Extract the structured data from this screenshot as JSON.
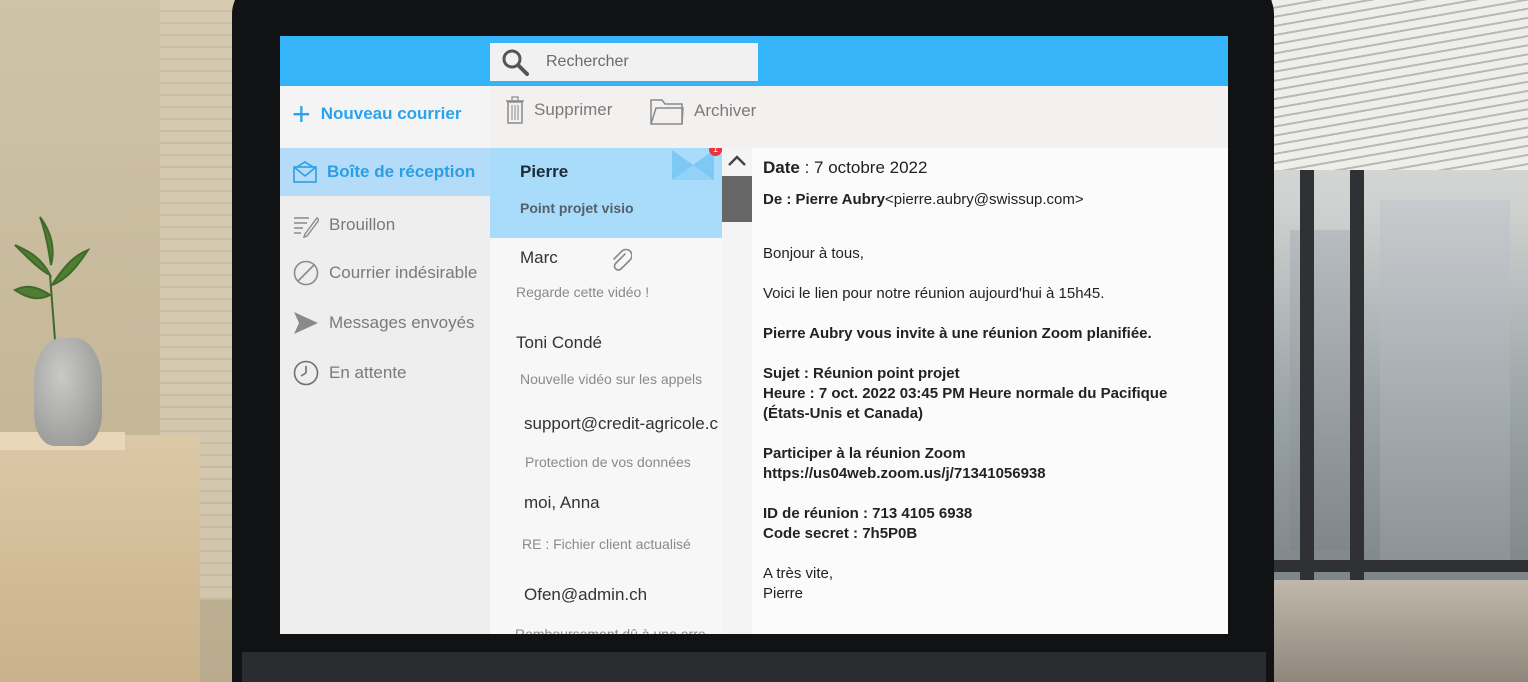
{
  "search": {
    "placeholder": "Rechercher"
  },
  "toolbar": {
    "new_mail": "Nouveau courrier",
    "delete": "Supprimer",
    "archive": "Archiver"
  },
  "sidebar": {
    "items": [
      {
        "label": "Boîte de réception",
        "icon": "inbox-icon",
        "active": true
      },
      {
        "label": "Brouillon",
        "icon": "draft-icon"
      },
      {
        "label": "Courrier indésirable",
        "icon": "spam-icon"
      },
      {
        "label": "Messages envoyés",
        "icon": "send-icon"
      },
      {
        "label": "En attente",
        "icon": "clock-icon"
      }
    ]
  },
  "messages": [
    {
      "sender": "Pierre",
      "subject": "Point projet visio",
      "unread_badge": "1"
    },
    {
      "sender": "Marc",
      "subject": "Regarde cette vidéo !",
      "attachment": true
    },
    {
      "sender": "Toni Condé",
      "subject": "Nouvelle vidéo sur les appels"
    },
    {
      "sender": "support@credit-agricole.c",
      "subject": "Protection de vos données"
    },
    {
      "sender": "moi, Anna",
      "subject": "RE : Fichier client actualisé"
    },
    {
      "sender": "Ofen@admin.ch",
      "subject": "Remboursement dû à une erre"
    }
  ],
  "email": {
    "date_label": "Date",
    "date_value": " : 7 octobre 2022",
    "from_label": "De : Pierre Aubry",
    "from_address": "<pierre.aubry@swissup.com>",
    "greeting": "Bonjour à tous,",
    "intro": "Voici le lien pour notre réunion aujourd'hui à 15h45.",
    "invite": "Pierre Aubry vous invite à une réunion Zoom planifiée.",
    "subject_line": "Sujet : Réunion point projet",
    "time_line_1": "Heure : 7 oct. 2022 03:45 PM Heure normale du Pacifique",
    "time_line_2": "(États-Unis et Canada)",
    "join_label": "Participer à la réunion Zoom",
    "join_link": "https://us04web.zoom.us/j/71341056938",
    "meeting_id": "ID de réunion : 713 4105 6938",
    "passcode": "Code secret : 7h5P0B",
    "closing": "A très vite,",
    "signature": "Pierre"
  },
  "colors": {
    "accent": "#35b4fa",
    "selected": "#a9dbfb",
    "badge": "#e8343f"
  }
}
